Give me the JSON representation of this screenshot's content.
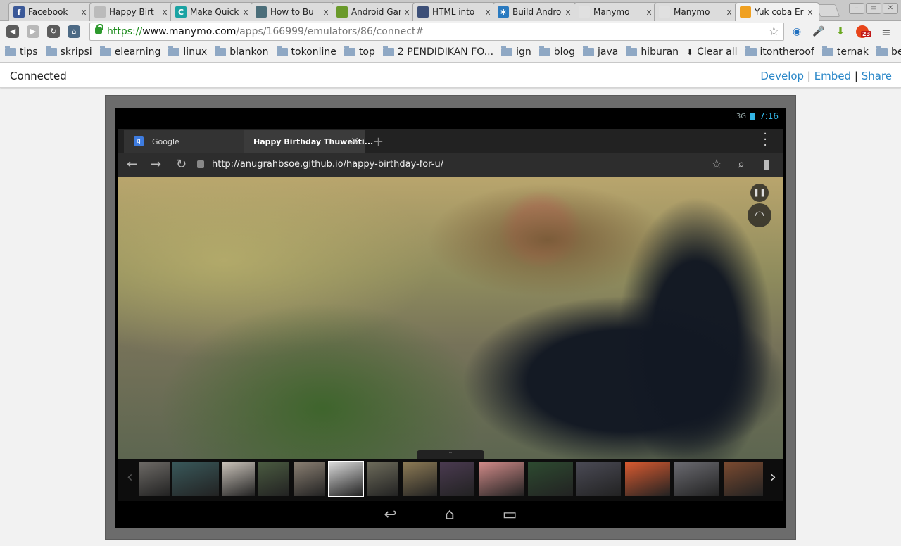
{
  "tabs": [
    {
      "title": "Facebook",
      "icon": "facebook-icon",
      "color": "#3b5998",
      "glyph": "f"
    },
    {
      "title": "Happy Birt",
      "icon": "page-icon",
      "color": "#bbbbbb",
      "glyph": ""
    },
    {
      "title": "Make Quick",
      "icon": "circle-c-icon",
      "color": "#1aa3a3",
      "glyph": "C"
    },
    {
      "title": "How to Bu",
      "icon": "sourceforge-icon",
      "color": "#4b6e7a",
      "glyph": ""
    },
    {
      "title": "Android Gar",
      "icon": "android-game-icon",
      "color": "#6a9a2a",
      "glyph": ""
    },
    {
      "title": "HTML into",
      "icon": "blogger-avatar-icon",
      "color": "#3c4f78",
      "glyph": ""
    },
    {
      "title": "Build Andro",
      "icon": "build-gear-icon",
      "color": "#2a7ac0",
      "glyph": "✱"
    },
    {
      "title": "Manymo",
      "icon": "page-icon",
      "color": "#e0e0e0",
      "glyph": ""
    },
    {
      "title": "Manymo",
      "icon": "page-icon",
      "color": "#e0e0e0",
      "glyph": ""
    },
    {
      "title": "Yuk coba Er",
      "icon": "robot-icon",
      "color": "#f0a020",
      "glyph": ""
    }
  ],
  "close_glyph": "x",
  "address": {
    "scheme": "https://",
    "host": "www.manymo.com",
    "path": "/apps/166999/emulators/86/connect#"
  },
  "badge": "23",
  "bookmarks": [
    "tips",
    "skripsi",
    "elearning",
    "linux",
    "blankon",
    "tokonline",
    "top",
    "2 PENDIDIKAN FO...",
    "ign",
    "blog",
    "java",
    "hiburan",
    "Clear all",
    "itontheroof",
    "ternak",
    "bea"
  ],
  "manymo": {
    "status": "Connected",
    "develop": "Develop",
    "sep": "|",
    "embed": "Embed",
    "share": "Share"
  },
  "android": {
    "time": "7:16",
    "net": "3G",
    "tab1": "Google",
    "tab2": "Happy Birthday Thuwenti...",
    "url": "http://anugrahbsoe.github.io/happy-birthday-for-u/"
  },
  "colors": {
    "link": "#2a87c8",
    "accent": "#33b5e5",
    "secure": "#1a8a1a"
  }
}
